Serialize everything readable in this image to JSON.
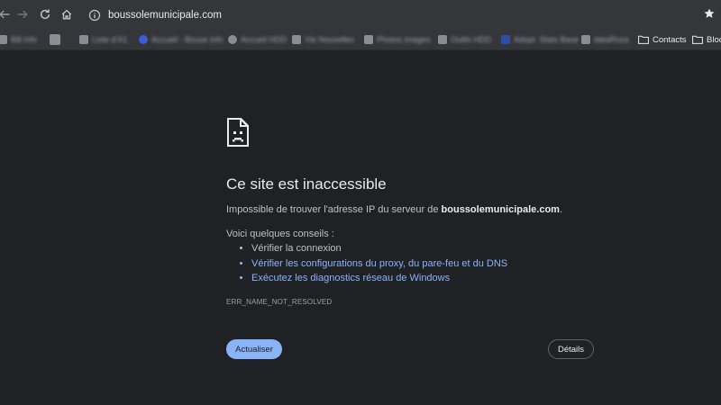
{
  "browser": {
    "url": "boussolemunicipale.com",
    "bookmarks": [
      {
        "label": "Bill info",
        "blurred": true
      },
      {
        "label": "",
        "blurred": true
      },
      {
        "label": "Liste d'A1",
        "blurred": true
      },
      {
        "label": "Accueil - Bouse info",
        "blurred": true
      },
      {
        "label": "Accueil HDD",
        "blurred": true
      },
      {
        "label": "Vie Nouvelles",
        "blurred": true
      },
      {
        "label": "Photos images",
        "blurred": true
      },
      {
        "label": "Outils HDD",
        "blurred": true
      },
      {
        "label": "Adopt. Stats Base",
        "blurred": true
      },
      {
        "label": "dataRoza",
        "blurred": true
      },
      {
        "label": "Contacts",
        "blurred": false
      },
      {
        "label": "Bloc",
        "blurred": false
      }
    ]
  },
  "error_page": {
    "title": "Ce site est inaccessible",
    "description_prefix": "Impossible de trouver l'adresse IP du serveur de ",
    "domain": "boussolemunicipale.com",
    "description_suffix": ".",
    "tips_heading": "Voici quelques conseils :",
    "tips": [
      {
        "label": "Vérifier la connexion",
        "link": false
      },
      {
        "label": "Vérifier les configurations du proxy, du pare-feu et du DNS",
        "link": true
      },
      {
        "label": "Exécutez les diagnostics réseau de Windows",
        "link": true
      }
    ],
    "error_code": "ERR_NAME_NOT_RESOLVED",
    "reload_label": "Actualiser",
    "details_label": "Détails"
  },
  "colors": {
    "background": "#202124",
    "link": "#8ab4f8",
    "button_primary": "#8ab4f8"
  }
}
